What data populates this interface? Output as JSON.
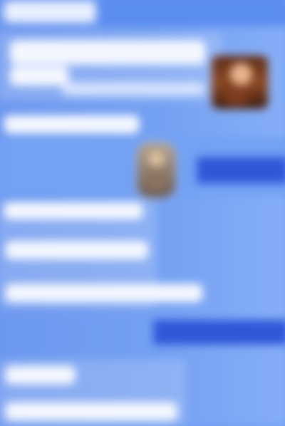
{
  "screen": {
    "type": "blurred_feed",
    "background_color": "#6f9af0",
    "accent_color": "#2f57d8"
  },
  "images": [
    {
      "type": "portrait",
      "colors": [
        "#5c2b16",
        "#8d4a25",
        "#e8b48f"
      ]
    },
    {
      "type": "portrait",
      "colors": [
        "#b7a48f",
        "#8f7f71",
        "#e1c4a1"
      ]
    }
  ]
}
